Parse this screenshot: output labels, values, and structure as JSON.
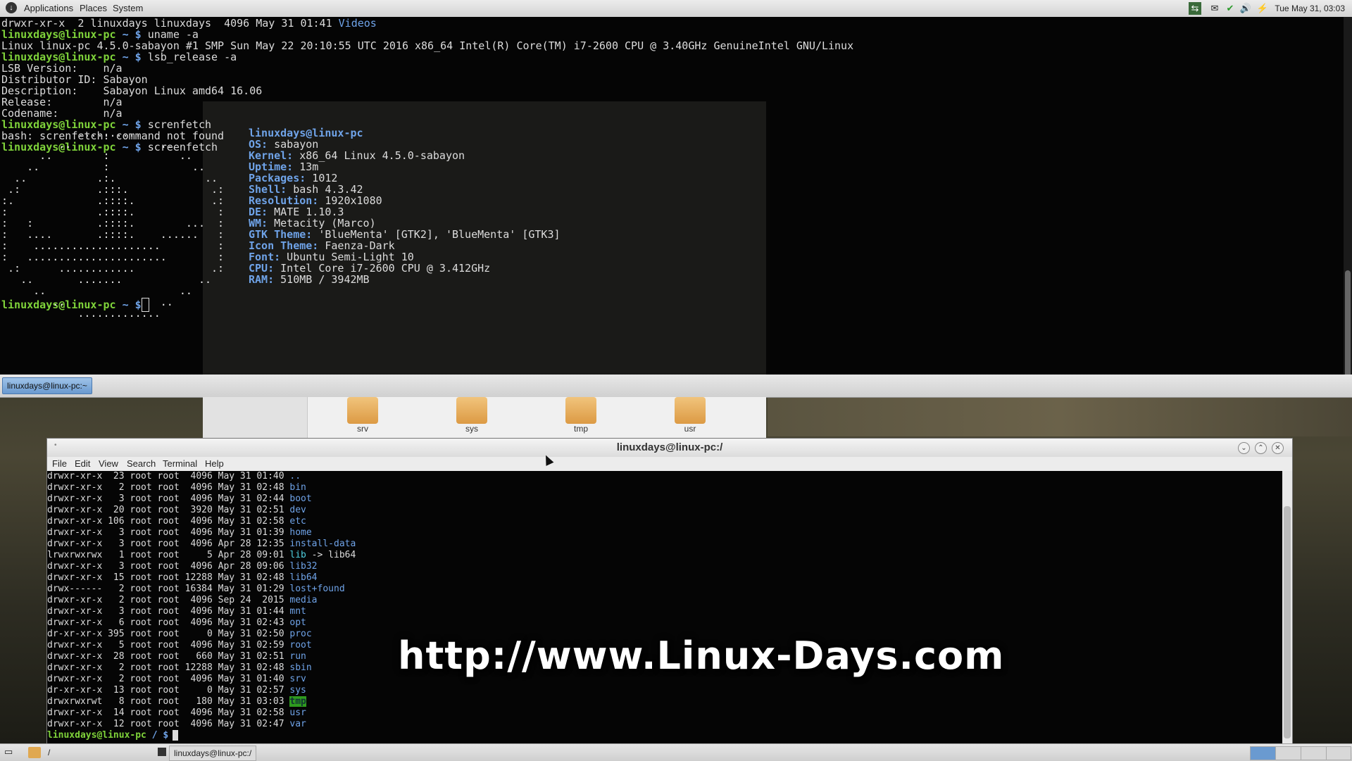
{
  "top_panel": {
    "menus": [
      "Applications",
      "Places",
      "System"
    ],
    "clock": "Tue May 31, 03:03"
  },
  "top_terminal": {
    "lines": [
      {
        "perm": "drwxr-xr-x  2 linuxdays linuxdays  4096 May 31 01:41 ",
        "name": "Videos"
      },
      {
        "prompt": "linuxdays@linux-pc",
        "path": " ~ $",
        "cmd": " uname -a"
      },
      {
        "text": "Linux linux-pc 4.5.0-sabayon #1 SMP Sun May 22 20:10:55 UTC 2016 x86_64 Intel(R) Core(TM) i7-2600 CPU @ 3.40GHz GenuineIntel GNU/Linux"
      },
      {
        "prompt": "linuxdays@linux-pc",
        "path": " ~ $",
        "cmd": " lsb_release -a"
      },
      {
        "text": "LSB Version:    n/a"
      },
      {
        "text": "Distributor ID: Sabayon"
      },
      {
        "text": "Description:    Sabayon Linux amd64 16.06"
      },
      {
        "text": "Release:        n/a"
      },
      {
        "text": "Codename:       n/a"
      },
      {
        "prompt": "linuxdays@linux-pc",
        "path": " ~ $",
        "cmd": " screnfetch"
      },
      {
        "text": "bash: screnfetch: command not found"
      },
      {
        "prompt": "linuxdays@linux-pc",
        "path": " ~ $",
        "cmd": " screenfetch"
      }
    ],
    "ascii_logo": [
      "            ..........",
      "         ..              ..",
      "      ..        :           ..",
      "    ..          :             ..",
      "  ..           .:.              ..",
      " .:            .:::.             .:",
      ":.             .::::.            .:",
      ":              .::::.             :",
      ":   :          .::::.        ...  :",
      ":   ....       .::::.    ......   :",
      ":    ....................         :",
      ":   ......................        :",
      " .:      ............            .:",
      "   ..       .......            ..",
      "     ..                     ..",
      "        ..               ..",
      "            ............."
    ],
    "sysinfo": [
      {
        "label": "",
        "value": "linuxdays@linux-pc"
      },
      {
        "label": "OS:",
        "value": " sabayon"
      },
      {
        "label": "Kernel:",
        "value": " x86_64 Linux 4.5.0-sabayon"
      },
      {
        "label": "Uptime:",
        "value": " 13m"
      },
      {
        "label": "Packages:",
        "value": " 1012"
      },
      {
        "label": "Shell:",
        "value": " bash 4.3.42"
      },
      {
        "label": "Resolution:",
        "value": " 1920x1080"
      },
      {
        "label": "DE:",
        "value": " MATE 1.10.3"
      },
      {
        "label": "WM:",
        "value": " Metacity (Marco)"
      },
      {
        "label": "GTK Theme:",
        "value": " 'BlueMenta' [GTK2], 'BlueMenta' [GTK3]"
      },
      {
        "label": "Icon Theme:",
        "value": " Faenza-Dark"
      },
      {
        "label": "Font:",
        "value": " Ubuntu Semi-Light 10"
      },
      {
        "label": "CPU:",
        "value": " Intel Core i7-2600 CPU @ 3.412GHz"
      },
      {
        "label": "RAM:",
        "value": " 510MB / 3942MB"
      }
    ],
    "final_prompt": "linuxdays@linux-pc",
    "final_path": " ~ $"
  },
  "term_taskbar": {
    "task": "linuxdays@linux-pc:~"
  },
  "file_manager": {
    "folders": [
      "srv",
      "sys",
      "tmp",
      "usr"
    ]
  },
  "main_terminal": {
    "title": "linuxdays@linux-pc:/",
    "menu": [
      "File",
      "Edit",
      "View",
      "Search",
      "Terminal",
      "Help"
    ],
    "rows": [
      {
        "perm": "drwxr-xr-x  23 root root  4096 May 31 01:40 ",
        "name": "..",
        "type": "dir"
      },
      {
        "perm": "drwxr-xr-x   2 root root  4096 May 31 02:48 ",
        "name": "bin",
        "type": "dir"
      },
      {
        "perm": "drwxr-xr-x   3 root root  4096 May 31 02:44 ",
        "name": "boot",
        "type": "dir"
      },
      {
        "perm": "drwxr-xr-x  20 root root  3920 May 31 02:51 ",
        "name": "dev",
        "type": "dir"
      },
      {
        "perm": "drwxr-xr-x 106 root root  4096 May 31 02:58 ",
        "name": "etc",
        "type": "dir"
      },
      {
        "perm": "drwxr-xr-x   3 root root  4096 May 31 01:39 ",
        "name": "home",
        "type": "dir"
      },
      {
        "perm": "drwxr-xr-x   3 root root  4096 Apr 28 12:35 ",
        "name": "install-data",
        "type": "dir"
      },
      {
        "perm": "lrwxrwxrwx   1 root root     5 Apr 28 09:01 ",
        "name": "lib",
        "type": "link",
        "target": " -> lib64"
      },
      {
        "perm": "drwxr-xr-x   3 root root  4096 Apr 28 09:06 ",
        "name": "lib32",
        "type": "dir"
      },
      {
        "perm": "drwxr-xr-x  15 root root 12288 May 31 02:48 ",
        "name": "lib64",
        "type": "dir"
      },
      {
        "perm": "drwx------   2 root root 16384 May 31 01:29 ",
        "name": "lost+found",
        "type": "dir"
      },
      {
        "perm": "drwxr-xr-x   2 root root  4096 Sep 24  2015 ",
        "name": "media",
        "type": "dir"
      },
      {
        "perm": "drwxr-xr-x   3 root root  4096 May 31 01:44 ",
        "name": "mnt",
        "type": "dir"
      },
      {
        "perm": "drwxr-xr-x   6 root root  4096 May 31 02:43 ",
        "name": "opt",
        "type": "dir"
      },
      {
        "perm": "dr-xr-xr-x 395 root root     0 May 31 02:50 ",
        "name": "proc",
        "type": "dir"
      },
      {
        "perm": "drwxr-xr-x   5 root root  4096 May 31 02:59 ",
        "name": "root",
        "type": "dir"
      },
      {
        "perm": "drwxr-xr-x  28 root root   660 May 31 02:51 ",
        "name": "run",
        "type": "dir"
      },
      {
        "perm": "drwxr-xr-x   2 root root 12288 May 31 02:48 ",
        "name": "sbin",
        "type": "dir"
      },
      {
        "perm": "drwxr-xr-x   2 root root  4096 May 31 01:40 ",
        "name": "srv",
        "type": "dir"
      },
      {
        "perm": "dr-xr-xr-x  13 root root     0 May 31 02:57 ",
        "name": "sys",
        "type": "dir"
      },
      {
        "perm": "drwxrwxrwt   8 root root   180 May 31 03:03 ",
        "name": "tmp",
        "type": "sticky"
      },
      {
        "perm": "drwxr-xr-x  14 root root  4096 May 31 02:58 ",
        "name": "usr",
        "type": "dir"
      },
      {
        "perm": "drwxr-xr-x  12 root root  4096 May 31 02:47 ",
        "name": "var",
        "type": "dir"
      }
    ],
    "final_prompt": "linuxdays@linux-pc",
    "final_path": " / $"
  },
  "watermark": "http://www.Linux-Days.com",
  "bottom_panel": {
    "tasks": [
      "/",
      "linuxdays@linux-pc:/"
    ]
  },
  "colors": {
    "prompt": "#7fd33a",
    "dir": "#6fa3e8",
    "tmp_highlight": "#2e9b1e"
  }
}
